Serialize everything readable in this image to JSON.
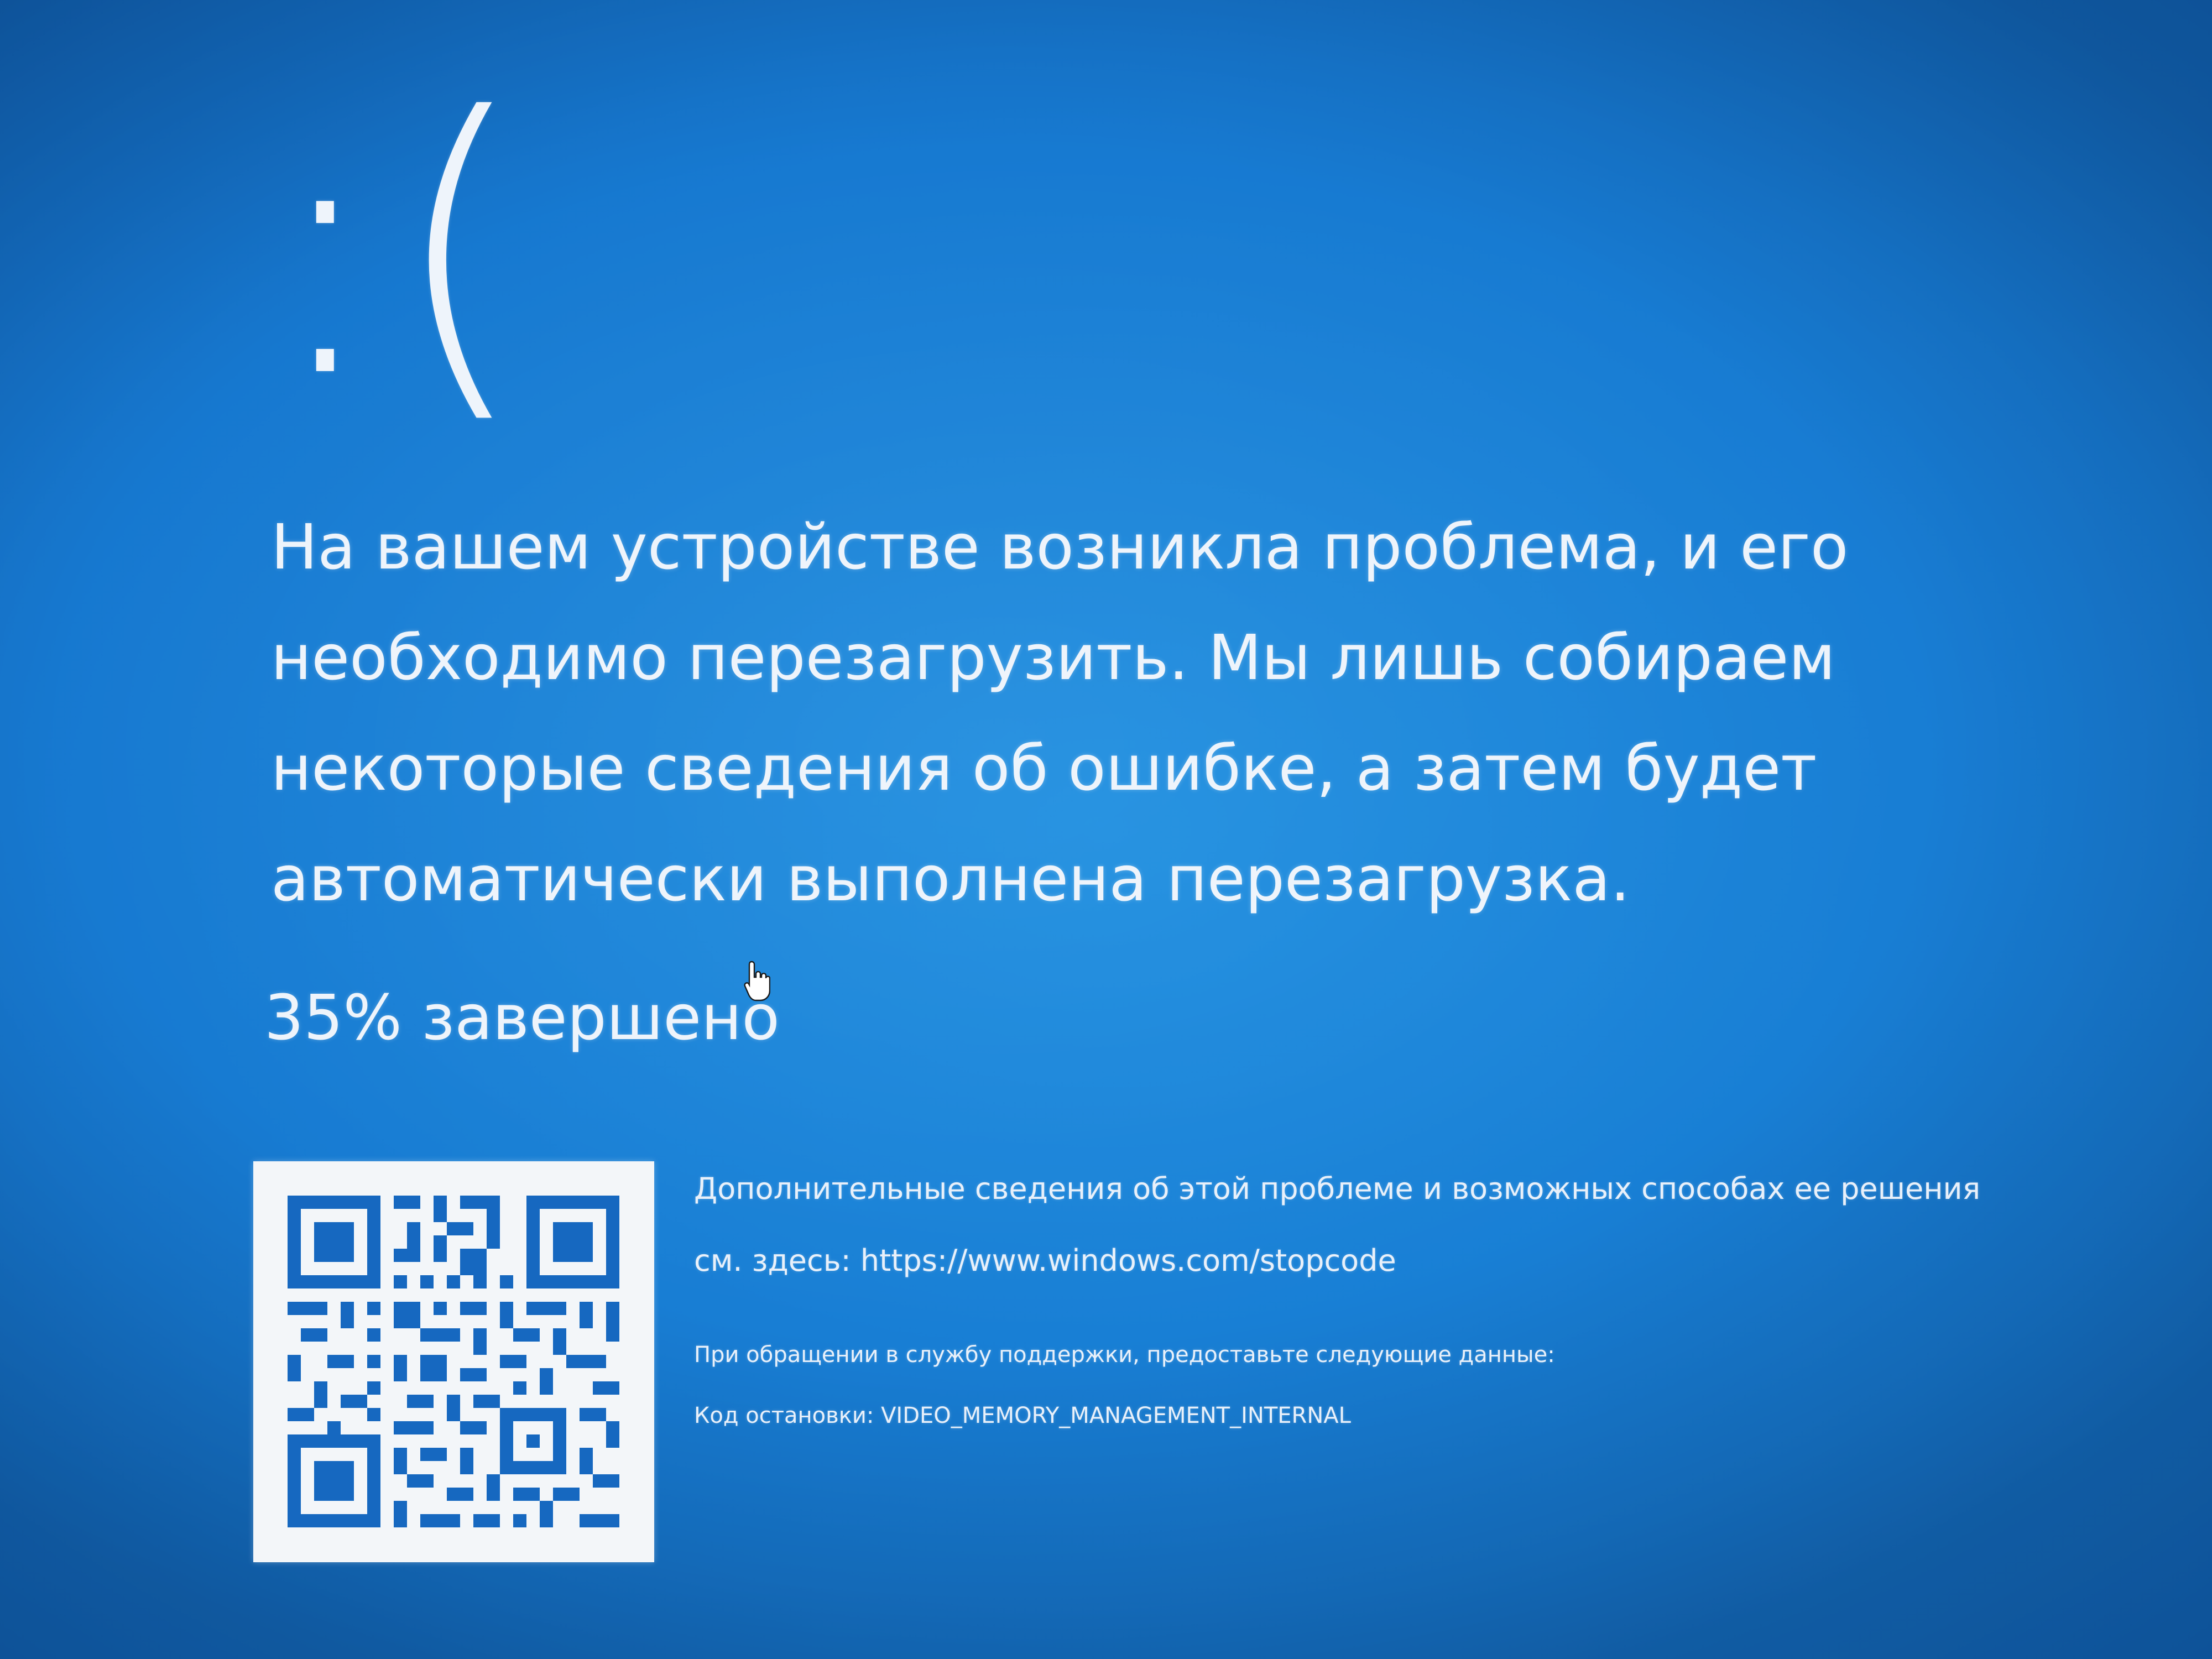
{
  "screen": {
    "background_color": "#1677cf",
    "sad_face": ":(",
    "message_lines": [
      "На вашем устройстве возникла проблема, и его",
      "необходимо перезагрузить. Мы лишь собираем",
      "некоторые сведения об ошибке, а затем будет",
      "автоматически выполнена перезагрузка."
    ],
    "progress_text": "35% завершено",
    "progress_percent": 35,
    "more_info_line1": "Дополнительные сведения об этой проблеме и возможных способах ее решения",
    "more_info_line2": "см. здесь: https://www.windows.com/stopcode",
    "support_line": "При обращении в службу поддержки, предоставьте следующие данные:",
    "stop_code_line": "Код остановки: VIDEO_MEMORY_MANAGEMENT_INTERNAL",
    "qr_icon": "qr-code-icon",
    "cursor_icon": "hand-pointer-icon"
  }
}
